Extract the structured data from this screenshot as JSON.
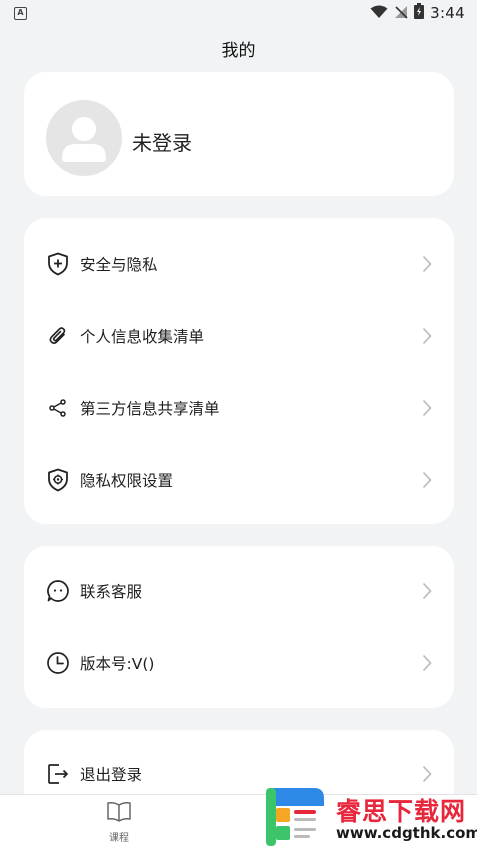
{
  "status_bar": {
    "time": "3:44",
    "notification_icon": "A"
  },
  "header": {
    "title": "我的"
  },
  "profile": {
    "name": "未登录",
    "avatar_icon": "user-avatar-icon"
  },
  "menu_group_1": [
    {
      "label": "安全与隐私",
      "icon": "shield-plus-icon"
    },
    {
      "label": "个人信息收集清单",
      "icon": "paperclip-icon"
    },
    {
      "label": "第三方信息共享清单",
      "icon": "share-icon"
    },
    {
      "label": "隐私权限设置",
      "icon": "shield-gear-icon"
    }
  ],
  "menu_group_2": [
    {
      "label": "联系客服",
      "icon": "chat-bubble-icon"
    },
    {
      "label": "版本号:V()",
      "icon": "clock-icon"
    }
  ],
  "menu_group_3": [
    {
      "label": "退出登录",
      "icon": "logout-icon"
    }
  ],
  "tab_bar": {
    "course_label": "课程"
  },
  "watermark": {
    "title": "睿思下载网",
    "url": "www.cdgthk.com"
  },
  "colors": {
    "background": "#f1f3f5",
    "card": "#ffffff",
    "watermark_red": "#e8273d"
  }
}
